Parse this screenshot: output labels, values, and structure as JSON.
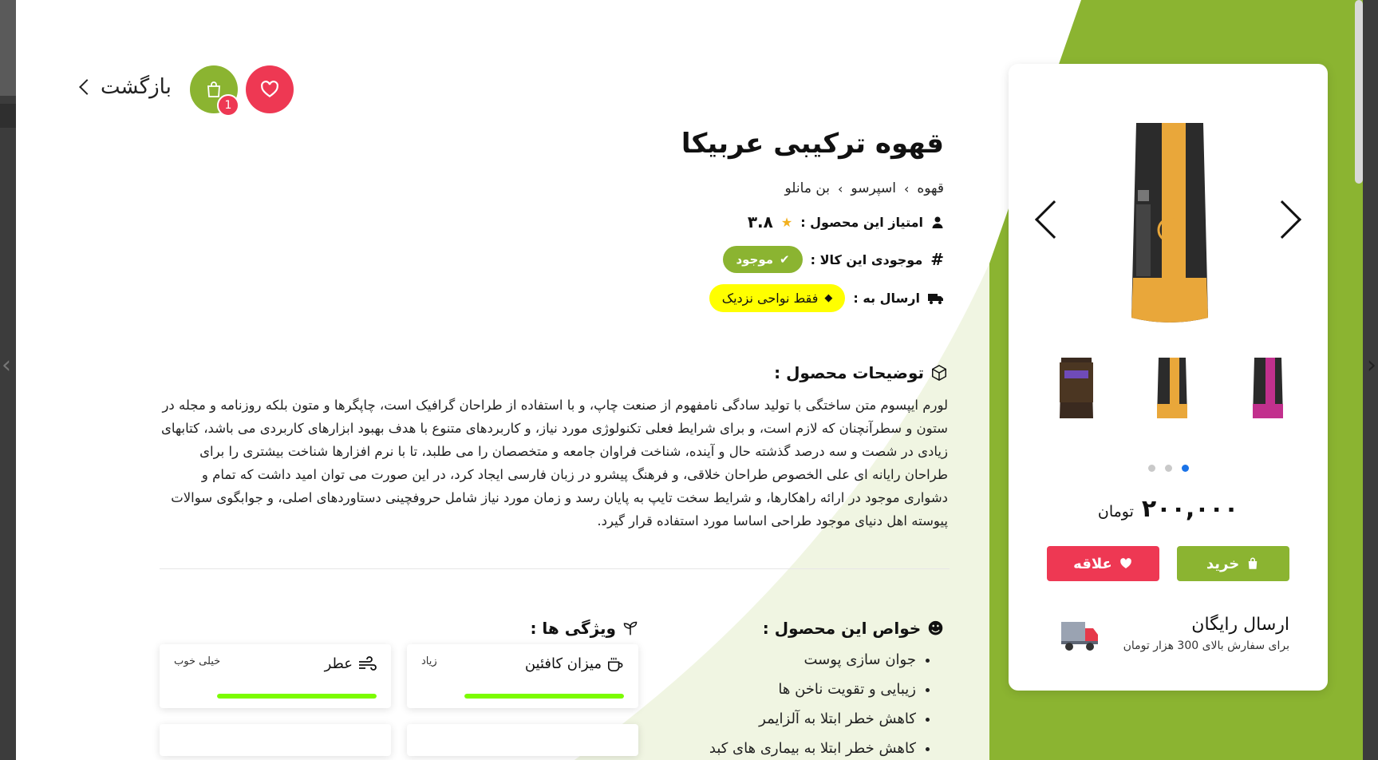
{
  "navigation": {
    "back_label": "بازگشت",
    "cart_count": "1"
  },
  "product": {
    "title": "قهوه ترکیبی عربیکا",
    "breadcrumbs": [
      "قهوه",
      "اسپرسو",
      "بن مانلو"
    ],
    "rating_label": "امتیاز این محصول :",
    "rating_value": "۳.۸",
    "stock_label": "موجودی این کالا :",
    "stock_status": "موجود",
    "shipping_label": "ارسال به :",
    "shipping_value": "فقط نواحی نزدیک"
  },
  "description": {
    "heading": "توضیحات محصول :",
    "text": "لورم ایپسوم متن ساختگی با تولید سادگی نامفهوم از صنعت چاپ، و با استفاده از طراحان گرافیک است، چاپگرها و متون بلکه روزنامه و مجله در ستون و سطرآنچنان که لازم است، و برای شرایط فعلی تکنولوژی مورد نیاز، و کاربردهای متنوع با هدف بهبود ابزارهای کاربردی می باشد، کتابهای زیادی در شصت و سه درصد گذشته حال و آینده، شناخت فراوان جامعه و متخصصان را می طلبد، تا با نرم افزارها شناخت بیشتری را برای طراحان رایانه ای علی الخصوص طراحان خلاقی، و فرهنگ پیشرو در زبان فارسی ایجاد کرد، در این صورت می توان امید داشت که تمام و دشواری موجود در ارائه راهکارها، و شرایط سخت تایپ به پایان رسد و زمان مورد نیاز شامل حروفچینی دستاوردهای اصلی، و جوابگوی سوالات پیوسته اهل دنیای موجود طراحی اساسا مورد استفاده قرار گیرد."
  },
  "properties": {
    "heading": "خواص این محصول :",
    "items": [
      "جوان سازی پوست",
      "زیبایی و تقویت ناخن ها",
      "کاهش خطر ابتلا به آلزایمر",
      "کاهش خطر ابتلا به بیماری های کبد"
    ]
  },
  "features": {
    "heading": "ویژگی ها :",
    "items": [
      {
        "name": "میزان کافئین",
        "level": "زیاد",
        "icon": "coffee-cup-icon",
        "fill": 1.0
      },
      {
        "name": "عطر",
        "level": "خیلی خوب",
        "icon": "wind-icon",
        "fill": 1.0
      }
    ]
  },
  "card": {
    "price": "۲۰۰,۰۰۰",
    "currency": "تومان",
    "buy_label": "خرید",
    "like_label": "علاقه",
    "shipping_title": "ارسال رایگان",
    "shipping_sub": "برای سفارش بالای 300 هزار تومان",
    "active_dot": 2
  },
  "colors": {
    "green": "#8bb431",
    "red": "#ee3853",
    "yellow": "#ffff00",
    "bar": "#7cfc00",
    "active_dot": "#1a73e8"
  },
  "icons": {
    "back": "chevron-left-icon",
    "cart": "shopping-bag-icon",
    "favorite": "heart-icon",
    "user": "user-icon",
    "star": "star-icon",
    "hash": "hash-icon",
    "truck": "truck-icon",
    "box": "box-icon",
    "brain": "brain-icon",
    "sprout": "sprout-icon",
    "check": "check-icon"
  }
}
